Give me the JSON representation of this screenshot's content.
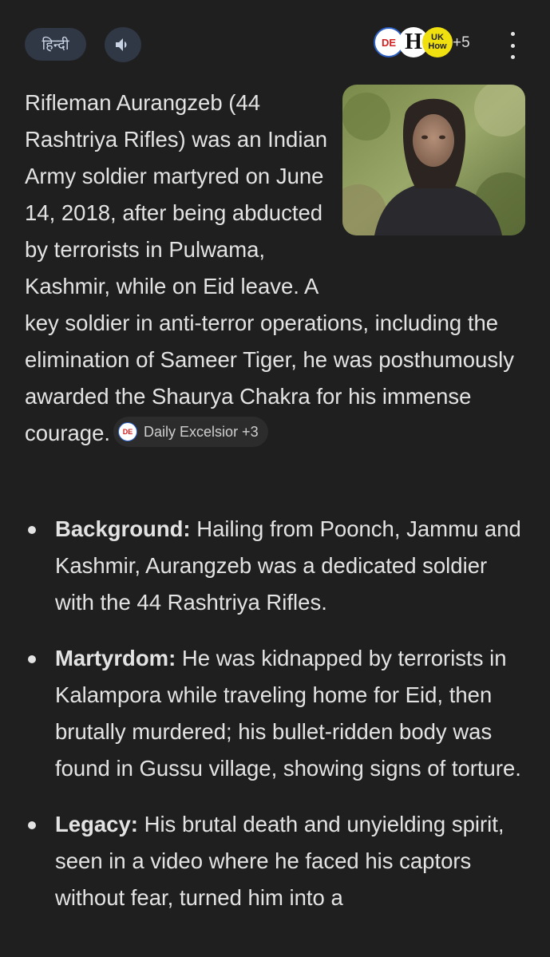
{
  "header": {
    "language_chip": "हिन्दी",
    "speaker": "speaker-icon",
    "sources": [
      {
        "abbr": "DE",
        "icon": "daily-excelsior-logo"
      },
      {
        "abbr": "H",
        "icon": "h-logo"
      },
      {
        "abbr_line1": "UK",
        "abbr_line2": "How",
        "icon": "uk-how-logo"
      }
    ],
    "more_sources": "+5",
    "menu": "more-vert-icon"
  },
  "summary": {
    "text": "Rifleman Aurangzeb (44 Rashtriya Rifles) was an Indian Army soldier martyred on June 14, 2018, after being abducted by terrorists in Pulwama, Kashmir, while on Eid leave. A key soldier in anti-terror operations, including the elimination of Sameer Tiger, he was posthumously awarded the Shaurya Chakra for his immense courage.",
    "citation_label": "Daily Excelsior +3",
    "citation_icon_abbr": "DE"
  },
  "bullets": [
    {
      "title": "Background:",
      "text": " Hailing from Poonch, Jammu and Kashmir, Aurangzeb was a dedicated soldier with the 44 Rashtriya Rifles."
    },
    {
      "title": "Martyrdom:",
      "text": " He was kidnapped by terrorists in Kalampora while traveling home for Eid, then brutally murdered; his bullet-ridden body was found in Gussu village, showing signs of torture."
    },
    {
      "title": "Legacy:",
      "text": " His brutal death and unyielding spirit, seen in a video where he faced his captors without fear, turned him into a"
    }
  ],
  "colors": {
    "background": "#1f1f1f",
    "text": "#e3e3e3",
    "chip": "#303845"
  }
}
